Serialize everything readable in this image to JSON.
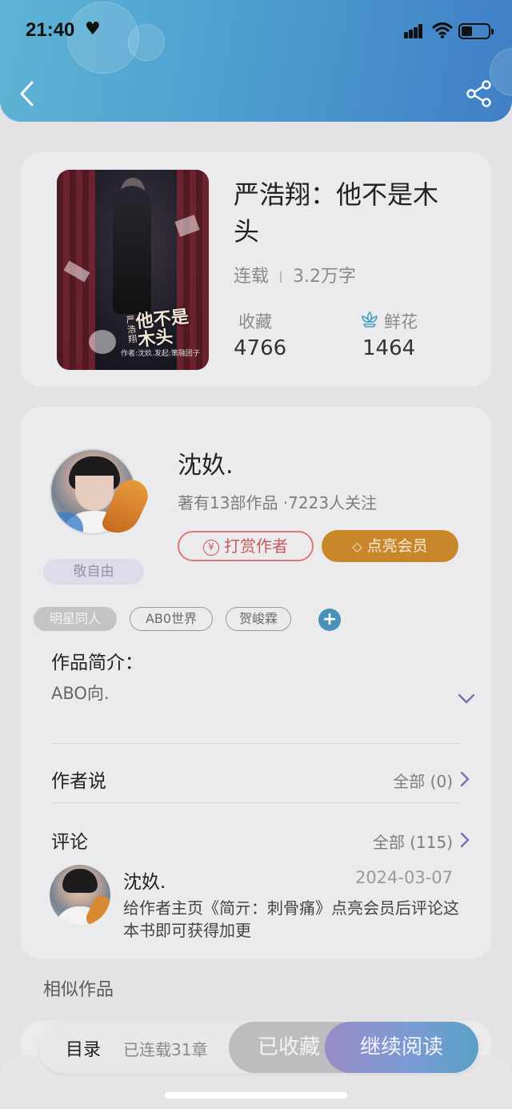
{
  "status_bar": {
    "time": "21:40",
    "heart": "♥"
  },
  "header": {
    "back_icon": "chevron-left-icon",
    "share_icon": "share-icon"
  },
  "book": {
    "title": "严浩翔：他不是木头",
    "cover_title": "他不是木头",
    "cover_tag": "严浩翔",
    "cover_author": "作者:沈奺.发起:策融团子",
    "status": "连载",
    "word_count": "3.2万字",
    "favorites_label": "收藏",
    "favorites_value": "4766",
    "flowers_label": "鲜花",
    "flowers_value": "1464"
  },
  "author": {
    "name": "沈奺.",
    "stats": "著有13部作品 ·7223人关注",
    "badge": "敬自由",
    "reward_button": "打赏作者",
    "vip_button": "点亮会员"
  },
  "tags": [
    "明星同人",
    "AB0世界",
    "贺峻霖"
  ],
  "intro": {
    "label": "作品简介：",
    "text": "ABO向."
  },
  "author_says": {
    "label": "作者说",
    "link": "全部 (0)"
  },
  "comments": {
    "label": "评论",
    "link": "全部 (115)",
    "items": [
      {
        "name": "沈奺.",
        "date": "2024-03-07",
        "text": "给作者主页《简亓：刺骨痛》点亮会员后评论这本书即可获得加更"
      }
    ]
  },
  "similar": {
    "label": "相似作品"
  },
  "bottom_bar": {
    "toc_label": "目录",
    "toc_count": "已连载31章",
    "fav_button": "已收藏",
    "read_button": "继续阅读"
  },
  "colors": {
    "header_start": "#5fb4d4",
    "header_end": "#3f7fc7",
    "vip": "#c9872b",
    "reward": "#d87a7a",
    "read_button": "#7a9bd4"
  }
}
